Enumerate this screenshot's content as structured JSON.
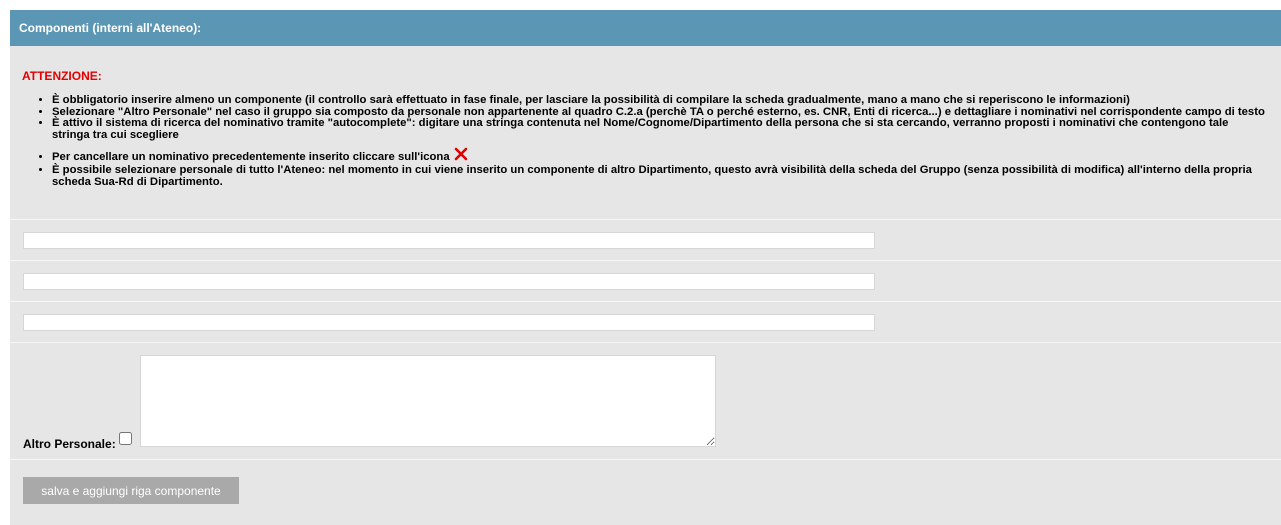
{
  "header": {
    "title": "Componenti (interni all'Ateneo):"
  },
  "notice": {
    "title": "ATTENZIONE:",
    "items": [
      "È obbligatorio inserire almeno un componente (il controllo sarà effettuato in fase finale, per lasciare la possibilità di compilare la scheda gradualmente, mano a mano che si reperiscono le informazioni)",
      "Selezionare \"Altro Personale\" nel caso il gruppo sia composto da personale non appartenente al quadro C.2.a (perchè TA o perché esterno, es. CNR, Enti di ricerca...) e dettagliare i nominativi nel corrispondente campo di testo",
      "È attivo il sistema di ricerca del nominativo tramite \"autocomplete\": digitare una stringa contenuta nel Nome/Cognome/Dipartimento della persona che si sta cercando, verranno proposti i nominativi che contengono tale stringa tra cui scegliere",
      "Per cancellare un nominativo precedentemente inserito cliccare sull'icona",
      "È possibile selezionare personale di tutto l'Ateneo: nel momento in cui viene inserito un componente di altro Dipartimento, questo avrà visibilità della scheda del Gruppo (senza possibilità di modifica) all'interno della propria scheda Sua-Rd di Dipartimento."
    ],
    "delete_icon": "close-x-icon",
    "delete_icon_color": "#e00000"
  },
  "componenti": [
    {
      "value": ""
    },
    {
      "value": ""
    },
    {
      "value": ""
    }
  ],
  "altro": {
    "label": "Altro Personale:",
    "checked": false,
    "text": ""
  },
  "actions": {
    "save_label": "salva e aggiungi riga componente"
  },
  "colors": {
    "header_bg": "#5b96b4",
    "panel_bg": "#e6e6e6",
    "warning": "#e60000",
    "button_bg": "#a9a9a9"
  }
}
